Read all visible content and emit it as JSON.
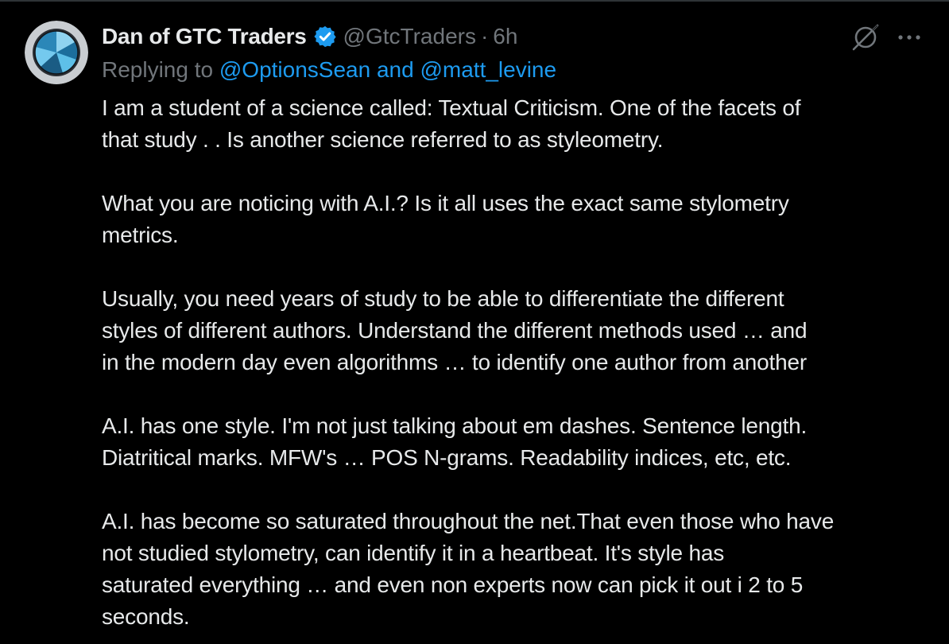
{
  "colors": {
    "background": "#000000",
    "text": "#e7e9ea",
    "muted": "#71767b",
    "accent": "#1d9bf0"
  },
  "tweet": {
    "author": {
      "display_name": "Dan of GTC Traders",
      "handle": "@GtcTraders",
      "time_separator": "·",
      "time": "6h",
      "verified_icon": "verified-badge-icon",
      "avatar_icon": "circle-logo-avatar"
    },
    "reply": {
      "prefix": "Replying to ",
      "mentions": "@OptionsSean and @matt_levine"
    },
    "paragraphs": [
      "I am a student of a science called: Textual Criticism.   One of the facets of\nthat study . . Is another science referred to as styleometry.",
      "What you are noticing with A.I.?  Is it all uses the exact same stylometry\nmetrics.",
      "Usually, you need years of study to be able to differentiate the different\nstyles of different authors.  Understand the different methods used … and\nin the modern day even algorithms … to identify one author from another",
      "A.I. has one style.  I'm not just talking about em dashes.  Sentence length.\nDiatritical marks.  MFW's … POS N-grams.  Readability indices, etc, etc.",
      "A.I. has become so saturated throughout the net.That even those who have\nnot studied stylometry, can identify it in a heartbeat.  It's style has\nsaturated everything … and even non experts now can pick it out i 2 to 5\nseconds."
    ],
    "actions": {
      "grok_icon": "grok-icon",
      "more_icon": "more-options-icon"
    }
  }
}
